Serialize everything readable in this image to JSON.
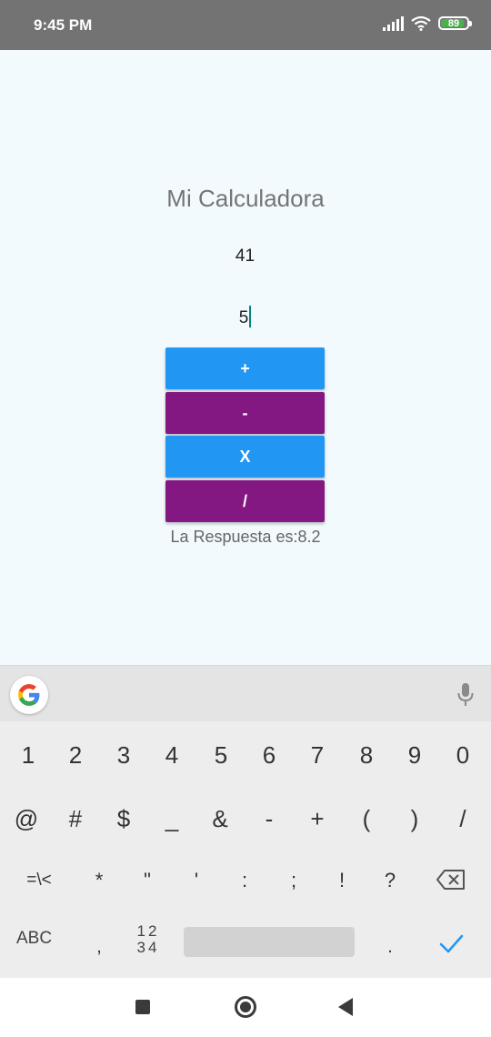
{
  "status_bar": {
    "time": "9:45 PM",
    "battery_percent": "89",
    "battery_level": 0.89,
    "icons": [
      "signal-icon",
      "wifi-icon",
      "battery-icon"
    ]
  },
  "app": {
    "title": "Mi Calculadora",
    "input1_value": "41",
    "input2_value": "5",
    "buttons": {
      "add": "+",
      "subtract": "-",
      "multiply": "X",
      "divide": "/"
    },
    "result_text": "La Respuesta es:8.2",
    "colors": {
      "blue_button": "#2196f3",
      "purple_button": "#841883",
      "background": "#f2fafd"
    }
  },
  "keyboard": {
    "row1": [
      "1",
      "2",
      "3",
      "4",
      "5",
      "6",
      "7",
      "8",
      "9",
      "0"
    ],
    "row2": [
      "@",
      "#",
      "$",
      "_",
      "&",
      "-",
      "+",
      "(",
      ")",
      "/"
    ],
    "row3": [
      "=\\<",
      "*",
      "\"",
      "'",
      ":",
      ";",
      "!",
      "?"
    ],
    "abc_label": "ABC",
    "comma": ",",
    "numpad_label_top": "12",
    "numpad_label_bottom": "34",
    "period": "."
  },
  "nav_bar": {
    "icons": [
      "recents-square-icon",
      "home-circle-icon",
      "back-triangle-icon"
    ]
  }
}
